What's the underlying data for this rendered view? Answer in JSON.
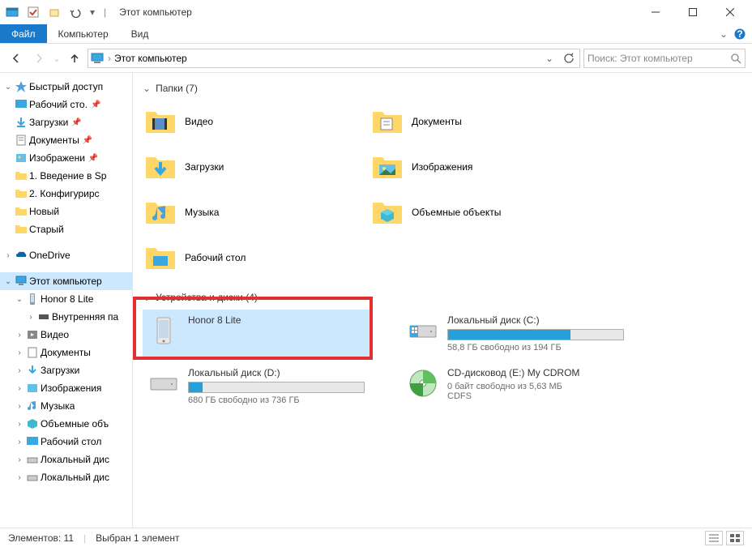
{
  "window": {
    "title": "Этот компьютер"
  },
  "ribbon": {
    "file": "Файл",
    "tabs": [
      "Компьютер",
      "Вид"
    ]
  },
  "nav": {
    "address": "Этот компьютер",
    "search_placeholder": "Поиск: Этот компьютер"
  },
  "sidebar": {
    "quick_access": "Быстрый доступ",
    "quick_items": [
      {
        "label": "Рабочий сто.",
        "pinned": true
      },
      {
        "label": "Загрузки",
        "pinned": true
      },
      {
        "label": "Документы",
        "pinned": true
      },
      {
        "label": "Изображени",
        "pinned": true
      },
      {
        "label": "1. Введение в Sp",
        "pinned": false
      },
      {
        "label": "2. Конфигурирс",
        "pinned": false
      },
      {
        "label": "Новый",
        "pinned": false
      },
      {
        "label": "Старый",
        "pinned": false
      }
    ],
    "onedrive": "OneDrive",
    "this_pc": "Этот компьютер",
    "honor": "Honor 8 Lite",
    "honor_sub": "Внутренняя па",
    "pc_items": [
      "Видео",
      "Документы",
      "Загрузки",
      "Изображения",
      "Музыка",
      "Объемные объ",
      "Рабочий стол",
      "Локальный дис",
      "Локальный дис"
    ]
  },
  "main": {
    "folders_header": "Папки (7)",
    "folders": [
      "Видео",
      "Документы",
      "Загрузки",
      "Изображения",
      "Музыка",
      "Объемные объекты",
      "Рабочий стол"
    ],
    "drives_header": "Устройства и диски (4)",
    "drives": [
      {
        "name": "Honor 8 Lite",
        "type": "device"
      },
      {
        "name": "Локальный диск (C:)",
        "stats": "58,8 ГБ свободно из 194 ГБ",
        "fill": 70
      },
      {
        "name": "Локальный диск (D:)",
        "stats": "680 ГБ свободно из 736 ГБ",
        "fill": 8
      },
      {
        "name": "CD-дисковод (E:) My CDROM",
        "stats": "0 байт свободно из 5,63 МБ",
        "fs": "CDFS"
      }
    ]
  },
  "statusbar": {
    "count": "Элементов: 11",
    "selection": "Выбран 1 элемент"
  }
}
